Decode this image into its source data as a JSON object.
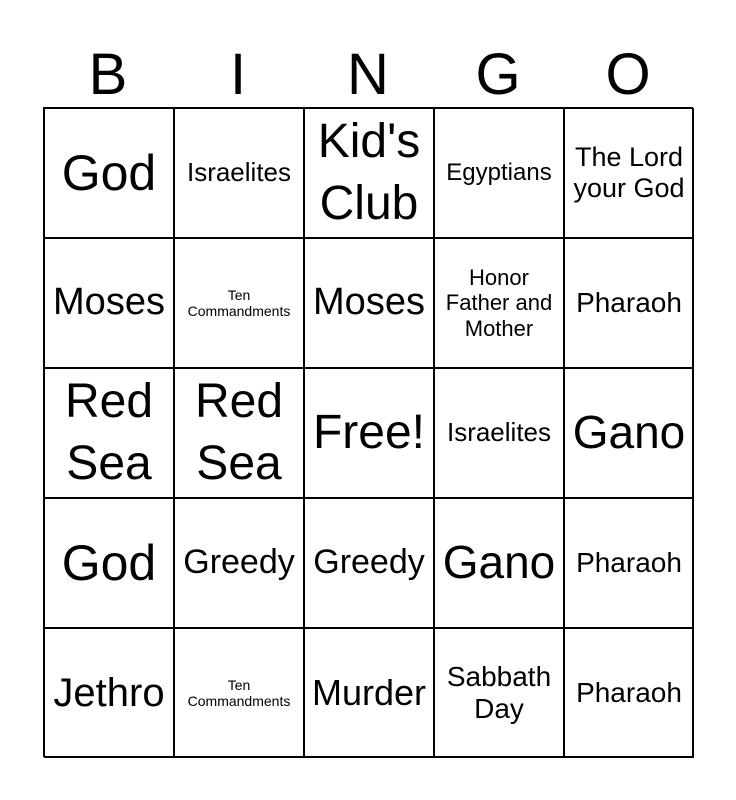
{
  "header": [
    "B",
    "I",
    "N",
    "G",
    "O"
  ],
  "cells": [
    [
      "God",
      "Israelites",
      "Kid's Club",
      "Egyptians",
      "The Lord your God"
    ],
    [
      "Moses",
      "Ten Commandments",
      "Moses",
      "Honor Father and Mother",
      "Pharaoh"
    ],
    [
      "Red Sea",
      "Red Sea",
      "Free!",
      "Israelites",
      "Gano"
    ],
    [
      "God",
      "Greedy",
      "Greedy",
      "Gano",
      "Pharaoh"
    ],
    [
      "Jethro",
      "Ten Commandments",
      "Murder",
      "Sabbath Day",
      "Pharaoh"
    ]
  ]
}
